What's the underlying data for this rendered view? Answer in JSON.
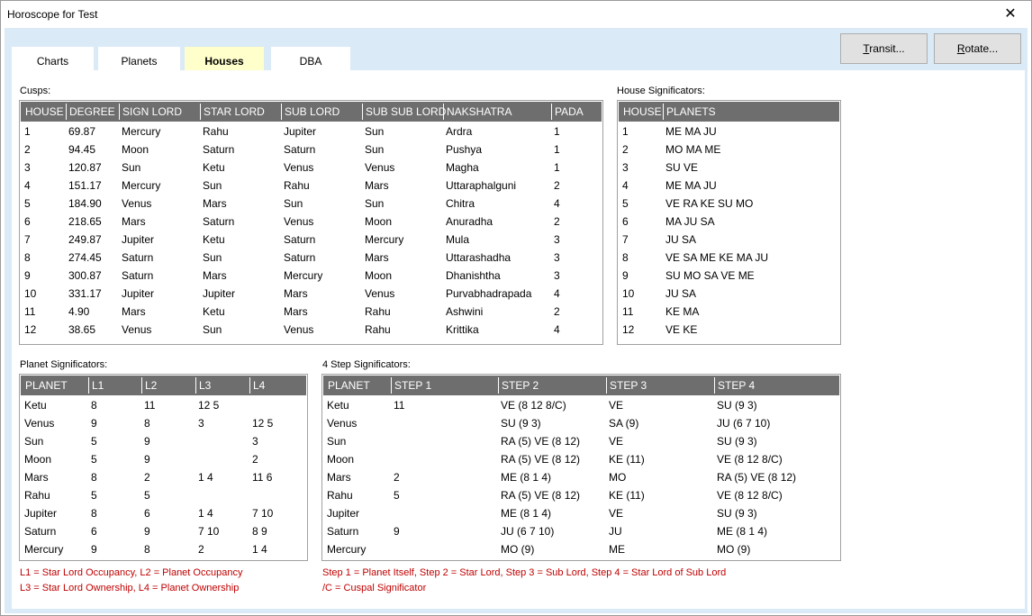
{
  "window": {
    "title": "Horoscope for Test",
    "close_glyph": "✕"
  },
  "tabs": [
    {
      "label": "Charts"
    },
    {
      "label": "Planets"
    },
    {
      "label": "Houses"
    },
    {
      "label": "DBA"
    }
  ],
  "active_tab": "Houses",
  "buttons": {
    "transit": {
      "accel": "T",
      "rest": "ransit..."
    },
    "rotate": {
      "accel": "R",
      "rest": "otate..."
    }
  },
  "cusps": {
    "label": "Cusps:",
    "columns": [
      "HOUSE",
      "DEGREE",
      "SIGN LORD",
      "STAR LORD",
      "SUB LORD",
      "SUB SUB LORD",
      "NAKSHATRA",
      "PADA"
    ],
    "rows": [
      [
        "1",
        "69.87",
        "Mercury",
        "Rahu",
        "Jupiter",
        "Sun",
        "Ardra",
        "1"
      ],
      [
        "2",
        "94.45",
        "Moon",
        "Saturn",
        "Saturn",
        "Sun",
        "Pushya",
        "1"
      ],
      [
        "3",
        "120.87",
        "Sun",
        "Ketu",
        "Venus",
        "Venus",
        "Magha",
        "1"
      ],
      [
        "4",
        "151.17",
        "Mercury",
        "Sun",
        "Rahu",
        "Mars",
        "Uttaraphalguni",
        "2"
      ],
      [
        "5",
        "184.90",
        "Venus",
        "Mars",
        "Sun",
        "Sun",
        "Chitra",
        "4"
      ],
      [
        "6",
        "218.65",
        "Mars",
        "Saturn",
        "Venus",
        "Moon",
        "Anuradha",
        "2"
      ],
      [
        "7",
        "249.87",
        "Jupiter",
        "Ketu",
        "Saturn",
        "Mercury",
        "Mula",
        "3"
      ],
      [
        "8",
        "274.45",
        "Saturn",
        "Sun",
        "Saturn",
        "Mars",
        "Uttarashadha",
        "3"
      ],
      [
        "9",
        "300.87",
        "Saturn",
        "Mars",
        "Mercury",
        "Moon",
        "Dhanishtha",
        "3"
      ],
      [
        "10",
        "331.17",
        "Jupiter",
        "Jupiter",
        "Mars",
        "Venus",
        "Purvabhadrapada",
        "4"
      ],
      [
        "11",
        "4.90",
        "Mars",
        "Ketu",
        "Mars",
        "Rahu",
        "Ashwini",
        "2"
      ],
      [
        "12",
        "38.65",
        "Venus",
        "Sun",
        "Venus",
        "Rahu",
        "Krittika",
        "4"
      ]
    ]
  },
  "house_significators": {
    "label": "House Significators:",
    "columns": [
      "HOUSE",
      "PLANETS"
    ],
    "rows": [
      [
        "1",
        "ME MA JU"
      ],
      [
        "2",
        "MO MA ME"
      ],
      [
        "3",
        "SU VE"
      ],
      [
        "4",
        "ME MA JU"
      ],
      [
        "5",
        "VE RA KE SU MO"
      ],
      [
        "6",
        "MA JU SA"
      ],
      [
        "7",
        "JU SA"
      ],
      [
        "8",
        "VE SA ME KE MA JU"
      ],
      [
        "9",
        "SU MO SA VE ME"
      ],
      [
        "10",
        "JU SA"
      ],
      [
        "11",
        "KE MA"
      ],
      [
        "12",
        "VE KE"
      ]
    ]
  },
  "planet_significators": {
    "label": "Planet Significators:",
    "columns": [
      "PLANET",
      "L1",
      "L2",
      "L3",
      "L4"
    ],
    "rows": [
      [
        "Ketu",
        "8",
        "11",
        "12 5",
        ""
      ],
      [
        "Venus",
        "9",
        "8",
        "3",
        "12 5"
      ],
      [
        "Sun",
        "5",
        "9",
        "",
        "3"
      ],
      [
        "Moon",
        "5",
        "9",
        "",
        "2"
      ],
      [
        "Mars",
        "8",
        "2",
        "1 4",
        "11 6"
      ],
      [
        "Rahu",
        "5",
        "5",
        "",
        ""
      ],
      [
        "Jupiter",
        "8",
        "6",
        "1 4",
        "7 10"
      ],
      [
        "Saturn",
        "6",
        "9",
        "7 10",
        "8 9"
      ],
      [
        "Mercury",
        "9",
        "8",
        "2",
        "1 4"
      ]
    ]
  },
  "step_significators": {
    "label": "4 Step Significators:",
    "columns": [
      "PLANET",
      "STEP 1",
      "STEP 2",
      "STEP 3",
      "STEP 4"
    ],
    "rows": [
      [
        "Ketu",
        "11",
        "VE (8 12 8/C)",
        "VE",
        "SU (9 3)"
      ],
      [
        "Venus",
        "",
        "SU (9 3)",
        "SA (9)",
        "JU (6 7 10)"
      ],
      [
        "Sun",
        "",
        "RA (5)  VE (8 12)",
        "VE",
        "SU (9 3)"
      ],
      [
        "Moon",
        "",
        "RA (5)  VE (8 12)",
        "KE (11)",
        "VE (8 12 8/C)"
      ],
      [
        "Mars",
        "2",
        "ME (8 1 4)",
        "MO",
        "RA (5)  VE (8 12)"
      ],
      [
        "Rahu",
        "5",
        "RA (5)  VE (8 12)",
        "KE (11)",
        "VE (8 12 8/C)"
      ],
      [
        "Jupiter",
        "",
        "ME (8 1 4)",
        "VE",
        "SU (9 3)"
      ],
      [
        "Saturn",
        "9",
        "JU (6 7 10)",
        "JU",
        "ME (8 1 4)"
      ],
      [
        "Mercury",
        "",
        "MO (9)",
        "ME",
        "MO (9)"
      ]
    ]
  },
  "legends": {
    "planet_1": "L1 = Star Lord Occupancy, L2 = Planet Occupancy",
    "planet_2": "L3 = Star Lord Ownership, L4 = Planet Ownership",
    "step_1": "Step 1 = Planet Itself, Step 2 = Star Lord, Step 3 = Sub Lord, Step 4 = Star Lord of Sub Lord",
    "step_2": "/C = Cuspal Significator"
  }
}
